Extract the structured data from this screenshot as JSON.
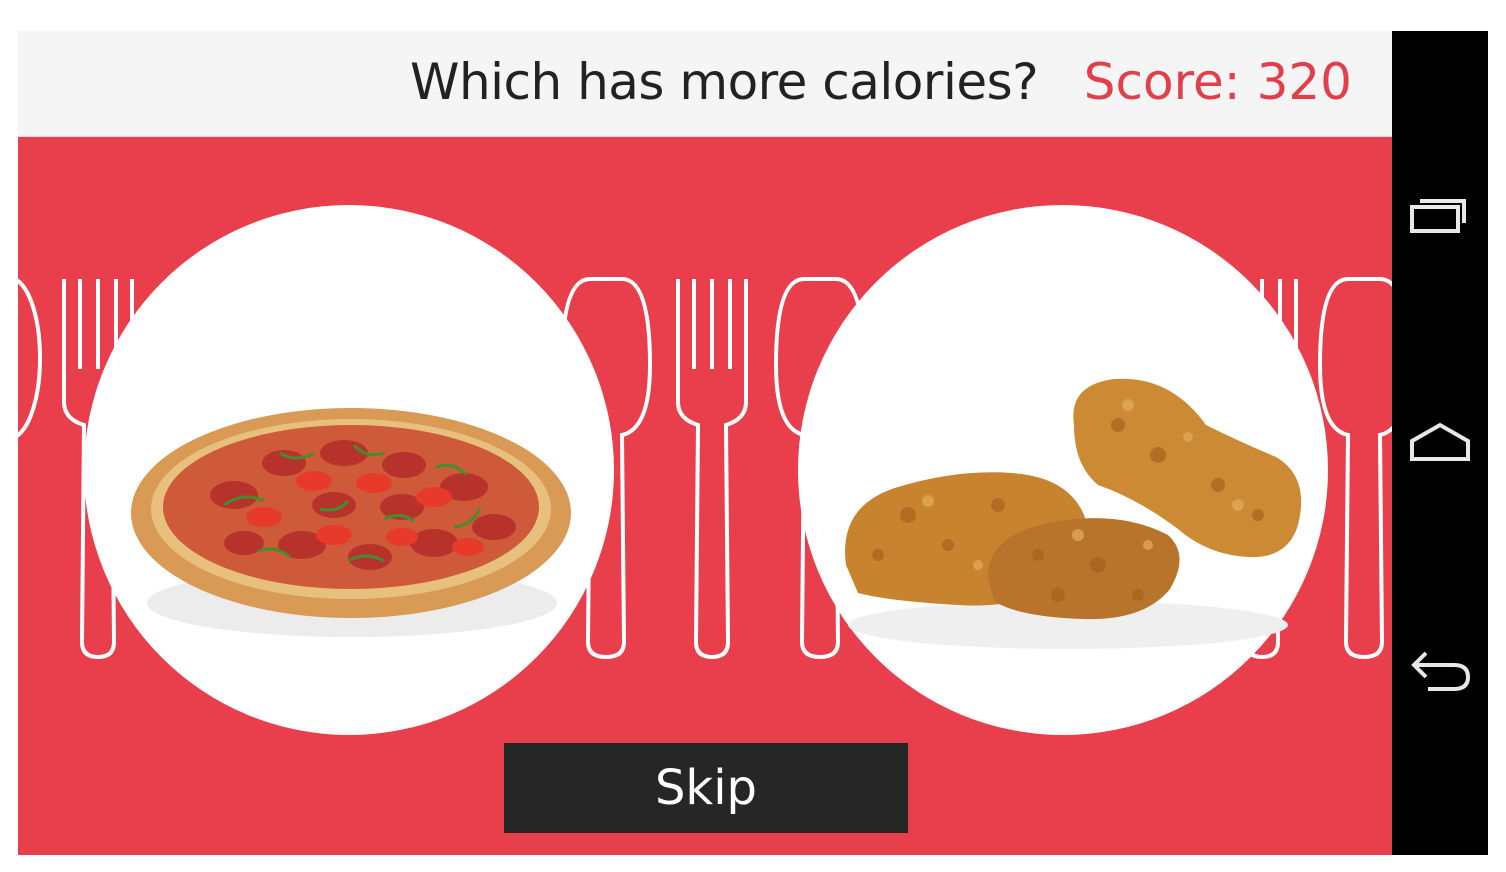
{
  "header": {
    "question": "Which has more calories?",
    "score_label": "Score:",
    "score_value": "320"
  },
  "choices": [
    {
      "name": "pizza",
      "icon": "pizza-image"
    },
    {
      "name": "fried-chicken",
      "icon": "fried-chicken-image"
    }
  ],
  "skip_label": "Skip",
  "nav_bar": {
    "icons": [
      "recent-apps-icon",
      "home-icon",
      "back-icon"
    ]
  },
  "colors": {
    "accent": "#e93e4c",
    "score_text": "#e23f4b",
    "header_bg": "#f5f5f5",
    "button_bg": "#262626"
  }
}
